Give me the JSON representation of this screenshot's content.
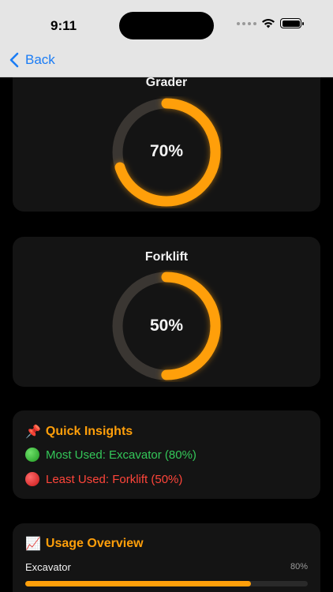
{
  "status_bar": {
    "time": "9:11"
  },
  "nav": {
    "back_label": "Back"
  },
  "gauges": [
    {
      "name": "Grader",
      "percent": 70,
      "percent_label": "70%"
    },
    {
      "name": "Forklift",
      "percent": 50,
      "percent_label": "50%"
    }
  ],
  "insights": {
    "emoji": "📌",
    "title": "Quick Insights",
    "most_used": "Most Used: Excavator (80%)",
    "least_used": "Least Used: Forklift (50%)"
  },
  "overview": {
    "emoji": "📈",
    "title": "Usage Overview",
    "items": [
      {
        "name": "Excavator",
        "percent": 80,
        "percent_label": "80%"
      }
    ]
  },
  "colors": {
    "accent": "#ff9f0a",
    "track": "#3a3632",
    "good": "#34c759",
    "bad": "#ff453a",
    "link": "#1a7cf5"
  }
}
